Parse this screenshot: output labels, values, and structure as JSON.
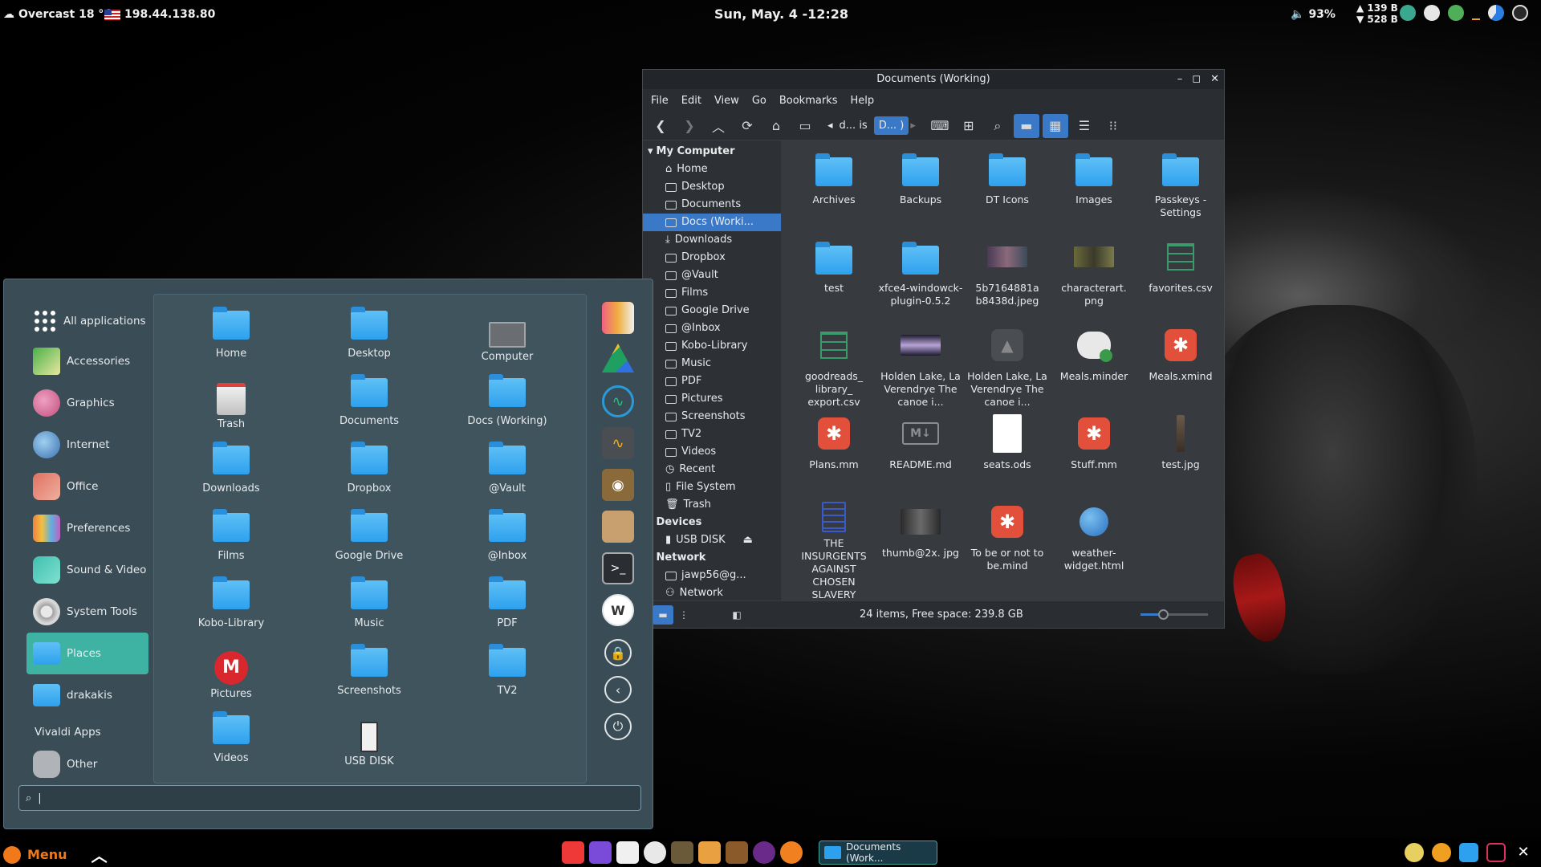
{
  "top_panel": {
    "weather": "Overcast 18 °C",
    "ip": "198.44.138.80",
    "clock": "Sun, May.  4 -12:28",
    "volume": "93%",
    "net_up": "139 B",
    "net_down": "528 B"
  },
  "file_manager": {
    "title": "Documents (Working)",
    "menu": [
      "File",
      "Edit",
      "View",
      "Go",
      "Bookmarks",
      "Help"
    ],
    "breadcrumbs": [
      "d... is",
      "D... )"
    ],
    "sidebar": {
      "my_computer": "My Computer",
      "items": [
        "Home",
        "Desktop",
        "Documents",
        "Docs (Worki...",
        "Downloads",
        "Dropbox",
        "@Vault",
        "Films",
        "Google Drive",
        "@Inbox",
        "Kobo-Library",
        "Music",
        "PDF",
        "Pictures",
        "Screenshots",
        "TV2",
        "Videos",
        "Recent",
        "File System",
        "Trash"
      ],
      "devices": "Devices",
      "device_items": [
        "USB DISK"
      ],
      "network": "Network",
      "network_items": [
        "jawp56@g...",
        "Network"
      ]
    },
    "files": [
      "Archives",
      "Backups",
      "DT Icons",
      "Images",
      "Passkeys - Settings",
      "test",
      "xfce4-windowck-plugin-0.5.2",
      "5b7164881a b8438d.jpeg",
      "characterart. png",
      "favorites.csv",
      "goodreads_ library_ export.csv",
      "Holden Lake, La Verendrye The canoe i...",
      "Holden Lake, La Verendrye The canoe i...",
      "Meals.minder",
      "Meals.xmind",
      "Plans.mm",
      "README.md",
      "seats.ods",
      "Stuff.mm",
      "test.jpg",
      "THE INSURGENTS AGAINST CHOSEN SLAVERY",
      "thumb@2x. jpg",
      "To be or not to be.mind",
      "weather-widget.html"
    ],
    "status": "24 items, Free space: 239.8 GB"
  },
  "menu": {
    "categories": [
      "All applications",
      "Accessories",
      "Graphics",
      "Internet",
      "Office",
      "Preferences",
      "Sound & Video",
      "System Tools",
      "Places",
      "drakakis"
    ],
    "vivaldi": "Vivaldi Apps",
    "other": "Other",
    "places": [
      "Home",
      "Desktop",
      "Computer",
      "Trash",
      "Documents",
      "Docs (Working)",
      "Downloads",
      "Dropbox",
      "@Vault",
      "Films",
      "Google Drive",
      "@Inbox",
      "Kobo-Library",
      "Music",
      "PDF",
      "Pictures",
      "Screenshots",
      "TV2",
      "Videos",
      "USB DISK"
    ],
    "search_value": "|"
  },
  "bottom_panel": {
    "menu_label": "Menu",
    "task_label": "Documents (Work..."
  },
  "colors": {
    "accent": "#3a79c7",
    "menu_selected": "#3fb3a3",
    "folder": "#2ea1ee",
    "menu_orange": "#f07a1a"
  }
}
